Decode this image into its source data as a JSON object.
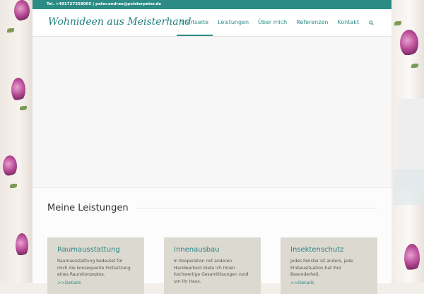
{
  "topbar": {
    "contact": "Tel. +491727258005 | peter.andrae@polsterpeter.de"
  },
  "header": {
    "logo": "Wohnideen aus Meisterhand"
  },
  "nav": {
    "items": [
      {
        "label": "Startseite",
        "active": true
      },
      {
        "label": "Leistungen",
        "active": false
      },
      {
        "label": "Über mich",
        "active": false
      },
      {
        "label": "Referenzen",
        "active": false
      },
      {
        "label": "Kontakt",
        "active": false
      }
    ],
    "search_icon": "search-icon"
  },
  "section": {
    "title": "Meine Leistungen"
  },
  "cards": [
    {
      "title": "Raumausstattung",
      "text": "Raumausstattung bedeutet für mich die konsequente Fortsetzung eines Raumkonzeptes.",
      "link": ">>Details"
    },
    {
      "title": "Innenausbau",
      "text": "In Kooperation mit anderen Handwerkern biete ich Ihnen hochwertige Gesamtlösungen rund um Ihr Haus.",
      "link": ""
    },
    {
      "title": "Insektenschutz",
      "text": "Jedes Fenster ist anders, jede Einbausituation hat ihre Besonderheit.",
      "link": ">>Details"
    }
  ],
  "colors": {
    "accent": "#2d8b86",
    "card_bg": "#dcd9d1"
  }
}
